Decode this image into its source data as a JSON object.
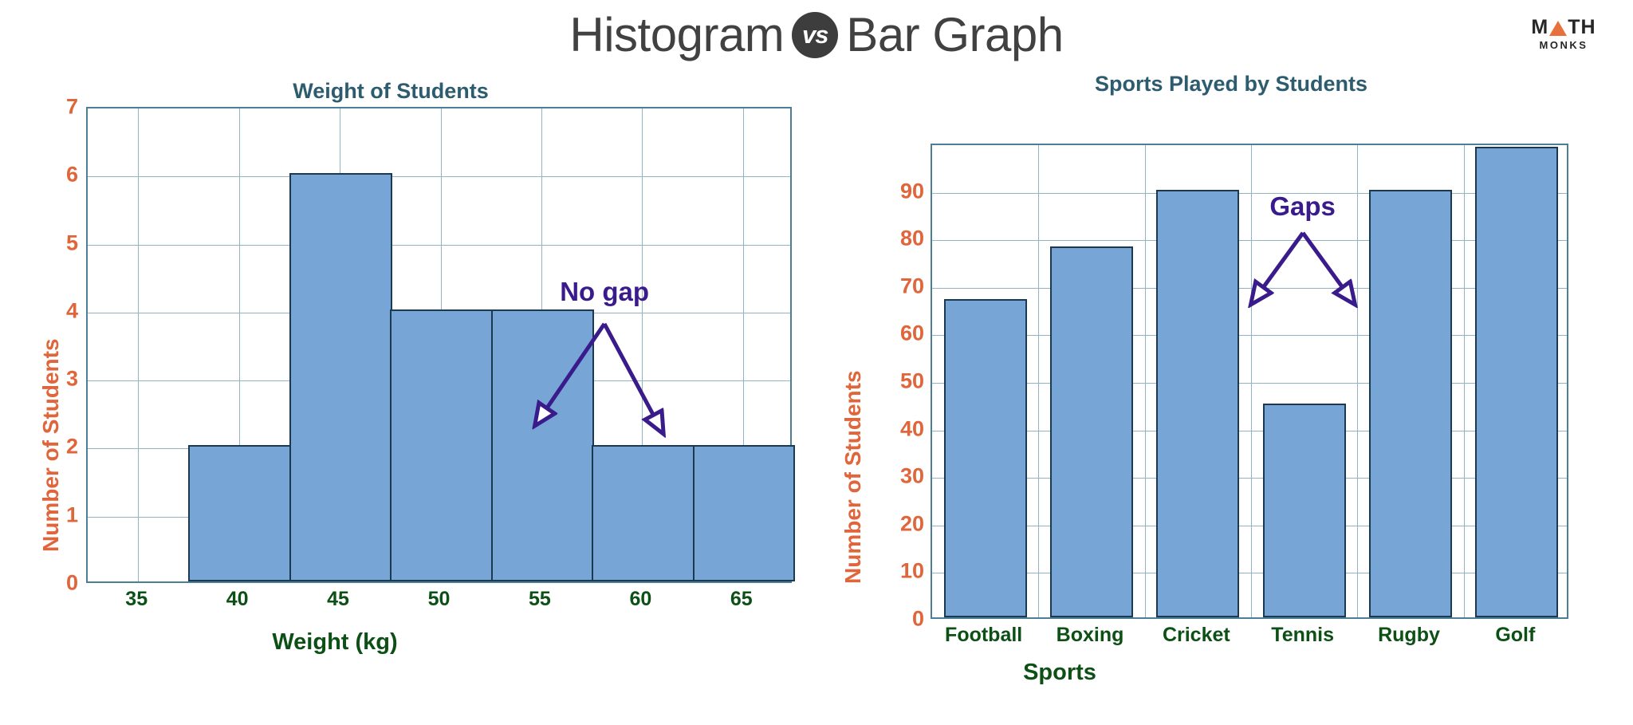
{
  "header": {
    "title_left": "Histogram",
    "vs_badge": "vs",
    "title_right": "Bar Graph",
    "logo": {
      "top_before": "M",
      "top_after": "TH",
      "bottom": "MONKS",
      "triangle_icon": "triangle-icon"
    }
  },
  "colors": {
    "bar_fill": "#77a5d5",
    "bar_stroke": "#1b3a52",
    "grid": "#8fb4c4",
    "axis_border": "#4a7f96",
    "y_tick_text": "#e0653a",
    "x_tick_text": "#0d5016",
    "chart_title": "#2d5c6e",
    "annotation": "#3a1b8c",
    "logo_accent": "#e8703a",
    "page_title": "#414141",
    "vs_badge_bg": "#3d3d3d"
  },
  "chart_data": [
    {
      "type": "bar",
      "id": "histogram",
      "title": "Weight of Students",
      "xlabel": "Weight (kg)",
      "ylabel": "Number of Students",
      "grid": true,
      "legend": "none",
      "xlim": [
        32.5,
        67.5
      ],
      "ylim": [
        0,
        7
      ],
      "yticks": [
        0,
        1,
        2,
        3,
        4,
        5,
        6,
        7
      ],
      "ytick_labels": [
        "0",
        "1",
        "2",
        "3",
        "4",
        "5",
        "6",
        "7"
      ],
      "xticks": [
        35,
        40,
        45,
        50,
        55,
        60,
        65
      ],
      "xtick_labels": [
        "35",
        "40",
        "45",
        "50",
        "55",
        "60",
        "65"
      ],
      "bins": [
        {
          "start": 37.5,
          "end": 42.5,
          "value": 2
        },
        {
          "start": 42.5,
          "end": 47.5,
          "value": 6
        },
        {
          "start": 47.5,
          "end": 52.5,
          "value": 4
        },
        {
          "start": 52.5,
          "end": 57.5,
          "value": 4
        },
        {
          "start": 57.5,
          "end": 62.5,
          "value": 2
        },
        {
          "start": 62.5,
          "end": 67.5,
          "value": 2
        }
      ],
      "annotation": {
        "text": "No gap",
        "kind": "double-arrow-down",
        "points_to": [
          "bin-4-left-edge",
          "bin-5-right-edge"
        ]
      }
    },
    {
      "type": "bar",
      "id": "bargraph",
      "title": "Sports Played by Students",
      "xlabel": "Sports",
      "ylabel": "Number of Students",
      "grid": true,
      "legend": "none",
      "ylim": [
        0,
        100
      ],
      "yticks": [
        0,
        10,
        20,
        30,
        40,
        50,
        60,
        70,
        80,
        90
      ],
      "ytick_labels": [
        "0",
        "10",
        "20",
        "30",
        "40",
        "50",
        "60",
        "70",
        "80",
        "90"
      ],
      "categories": [
        "Football",
        "Boxing",
        "Cricket",
        "Tennis",
        "Rugby",
        "Golf"
      ],
      "values": [
        67,
        78,
        90,
        45,
        90,
        99
      ],
      "annotation": {
        "text": "Gaps",
        "kind": "double-arrow-down",
        "points_to": [
          "gap-cricket-tennis",
          "gap-tennis-rugby"
        ]
      }
    }
  ]
}
